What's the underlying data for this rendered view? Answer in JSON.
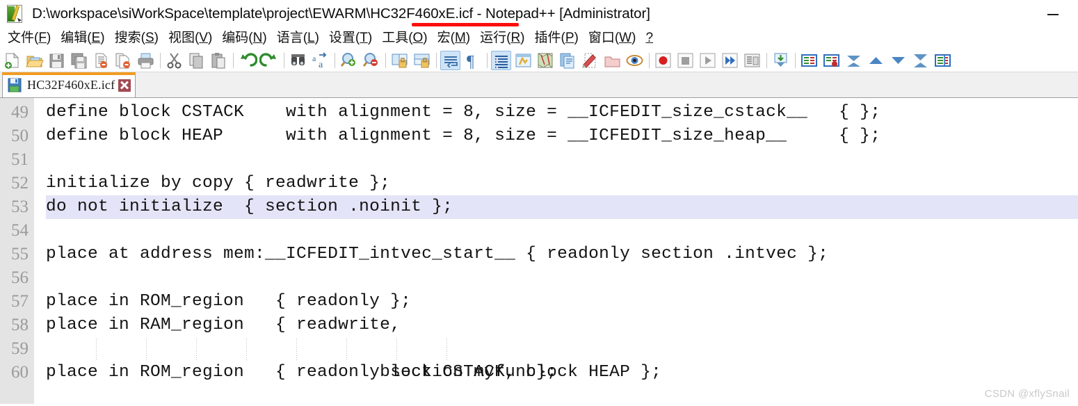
{
  "window": {
    "title": "D:\\workspace\\siWorkSpace\\template\\project\\EWARM\\HC32F460xE.icf - Notepad++ [Administrator]",
    "app_icon": "notepad-plus-plus-icon",
    "minimize_label": "—",
    "annotation_color": "#fd0d0d"
  },
  "menubar": {
    "items": [
      {
        "label": "文件(F)",
        "pre": "文件(",
        "key": "F",
        "post": ")"
      },
      {
        "label": "编辑(E)",
        "pre": "编辑(",
        "key": "E",
        "post": ")"
      },
      {
        "label": "搜索(S)",
        "pre": "搜索(",
        "key": "S",
        "post": ")"
      },
      {
        "label": "视图(V)",
        "pre": "视图(",
        "key": "V",
        "post": ")"
      },
      {
        "label": "编码(N)",
        "pre": "编码(",
        "key": "N",
        "post": ")"
      },
      {
        "label": "语言(L)",
        "pre": "语言(",
        "key": "L",
        "post": ")"
      },
      {
        "label": "设置(T)",
        "pre": "设置(",
        "key": "T",
        "post": ")"
      },
      {
        "label": "工具(O)",
        "pre": "工具(",
        "key": "O",
        "post": ")"
      },
      {
        "label": "宏(M)",
        "pre": "宏(",
        "key": "M",
        "post": ")"
      },
      {
        "label": "运行(R)",
        "pre": "运行(",
        "key": "R",
        "post": ")"
      },
      {
        "label": "插件(P)",
        "pre": "插件(",
        "key": "P",
        "post": ")"
      },
      {
        "label": "窗口(W)",
        "pre": "窗口(",
        "key": "W",
        "post": ")"
      },
      {
        "label": "?",
        "pre": "",
        "key": "?",
        "post": ""
      }
    ]
  },
  "toolbar": {
    "buttons": [
      "new-file-icon",
      "open-file-icon",
      "save-icon",
      "save-all-icon",
      "close-file-icon",
      "close-all-icon",
      "print-icon",
      "SEP",
      "cut-icon",
      "copy-icon",
      "paste-icon",
      "SEP",
      "undo-icon",
      "redo-icon",
      "SEP",
      "find-icon",
      "replace-icon",
      "SEP",
      "zoom-in-icon",
      "zoom-out-icon",
      "SEP",
      "sync-vertical-scroll-icon",
      "sync-horizontal-scroll-icon",
      "SEP",
      "word-wrap-icon",
      "show-all-characters-icon",
      "SEP",
      "indent-guideline-icon",
      "user-defined-language-icon",
      "document-map-icon",
      "function-list-icon",
      "show-clone-icon",
      "monitoring-icon",
      "SEP",
      "start-record-macro-icon",
      "stop-record-macro-icon",
      "play-macro-icon",
      "run-macro-multiple-icon",
      "save-macro-icon",
      "SEP",
      "run-icon",
      "SEP",
      "bookmark-icon",
      "toggle-fold-icon",
      "clear-bookmark-icon",
      "collapse-all-icon",
      "focus-up-icon",
      "focus-down-icon",
      "expand-all-icon",
      "split-view-icon"
    ],
    "selected": [
      "word-wrap-icon",
      "indent-guideline-icon"
    ]
  },
  "tabs": {
    "active_index": 0,
    "items": [
      {
        "label": "HC32F460xE.icf",
        "icon": "saved-floppy-icon",
        "close_icon": "close-tab-icon",
        "modified": false
      }
    ]
  },
  "editor": {
    "first_line": 49,
    "current_line": 53,
    "lines": [
      {
        "num": "49",
        "text": "define block CSTACK    with alignment = 8, size = __ICFEDIT_size_cstack__   { };"
      },
      {
        "num": "50",
        "text": "define block HEAP      with alignment = 8, size = __ICFEDIT_size_heap__     { };"
      },
      {
        "num": "51",
        "text": ""
      },
      {
        "num": "52",
        "text": "initialize by copy { readwrite };"
      },
      {
        "num": "53",
        "text": "do not initialize  { section .noinit };"
      },
      {
        "num": "54",
        "text": ""
      },
      {
        "num": "55",
        "text": "place at address mem:__ICFEDIT_intvec_start__ { readonly section .intvec };"
      },
      {
        "num": "56",
        "text": ""
      },
      {
        "num": "57",
        "text": "place in ROM_region   { readonly };"
      },
      {
        "num": "58",
        "text": "place in RAM_region   { readwrite,"
      },
      {
        "num": "59",
        "text": "                        block CSTACK, block HEAP };"
      },
      {
        "num": "60",
        "text": "place in ROM_region   { readonly section myfunc};"
      }
    ]
  },
  "watermark": {
    "text": "CSDN @xflySnail"
  }
}
